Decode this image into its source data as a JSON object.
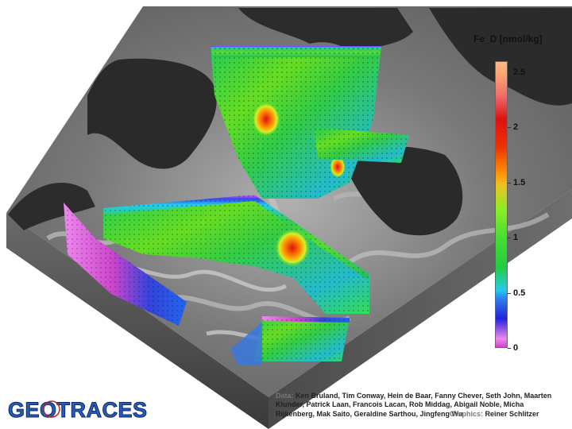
{
  "colorbar": {
    "title": "Fe_D [nmol/kg]",
    "ticks": [
      {
        "label": "2.5",
        "value": 2.5
      },
      {
        "label": "2",
        "value": 2
      },
      {
        "label": "1.5",
        "value": 1.5
      },
      {
        "label": "1",
        "value": 1
      },
      {
        "label": "0.5",
        "value": 0.5
      },
      {
        "label": "0",
        "value": 0
      }
    ],
    "range": [
      0,
      2.6
    ]
  },
  "logo": {
    "text": "GEOTRACES"
  },
  "credits": {
    "data_label": "Data:",
    "data_text": "Ken Bruland, Tim Conway, Hein de Baar, Fanny Chever, Seth John, Maarten Klunder, Patrick Laan, Francois Lacan, Rob Middag, Abigail Noble, Micha Rijkenberg, Mak Saito, Geraldine Sarthou, Jingfeng Wu",
    "graphics_label": "Graphics:",
    "graphics_text": "Reiner Schlitzer"
  },
  "colors": {
    "landmass": "#2a2a2a",
    "seafloor": "#8a8a8a",
    "box_side": "#555555",
    "low": "#cc44cc",
    "mid": "#33cc44",
    "high": "#ffa870"
  }
}
